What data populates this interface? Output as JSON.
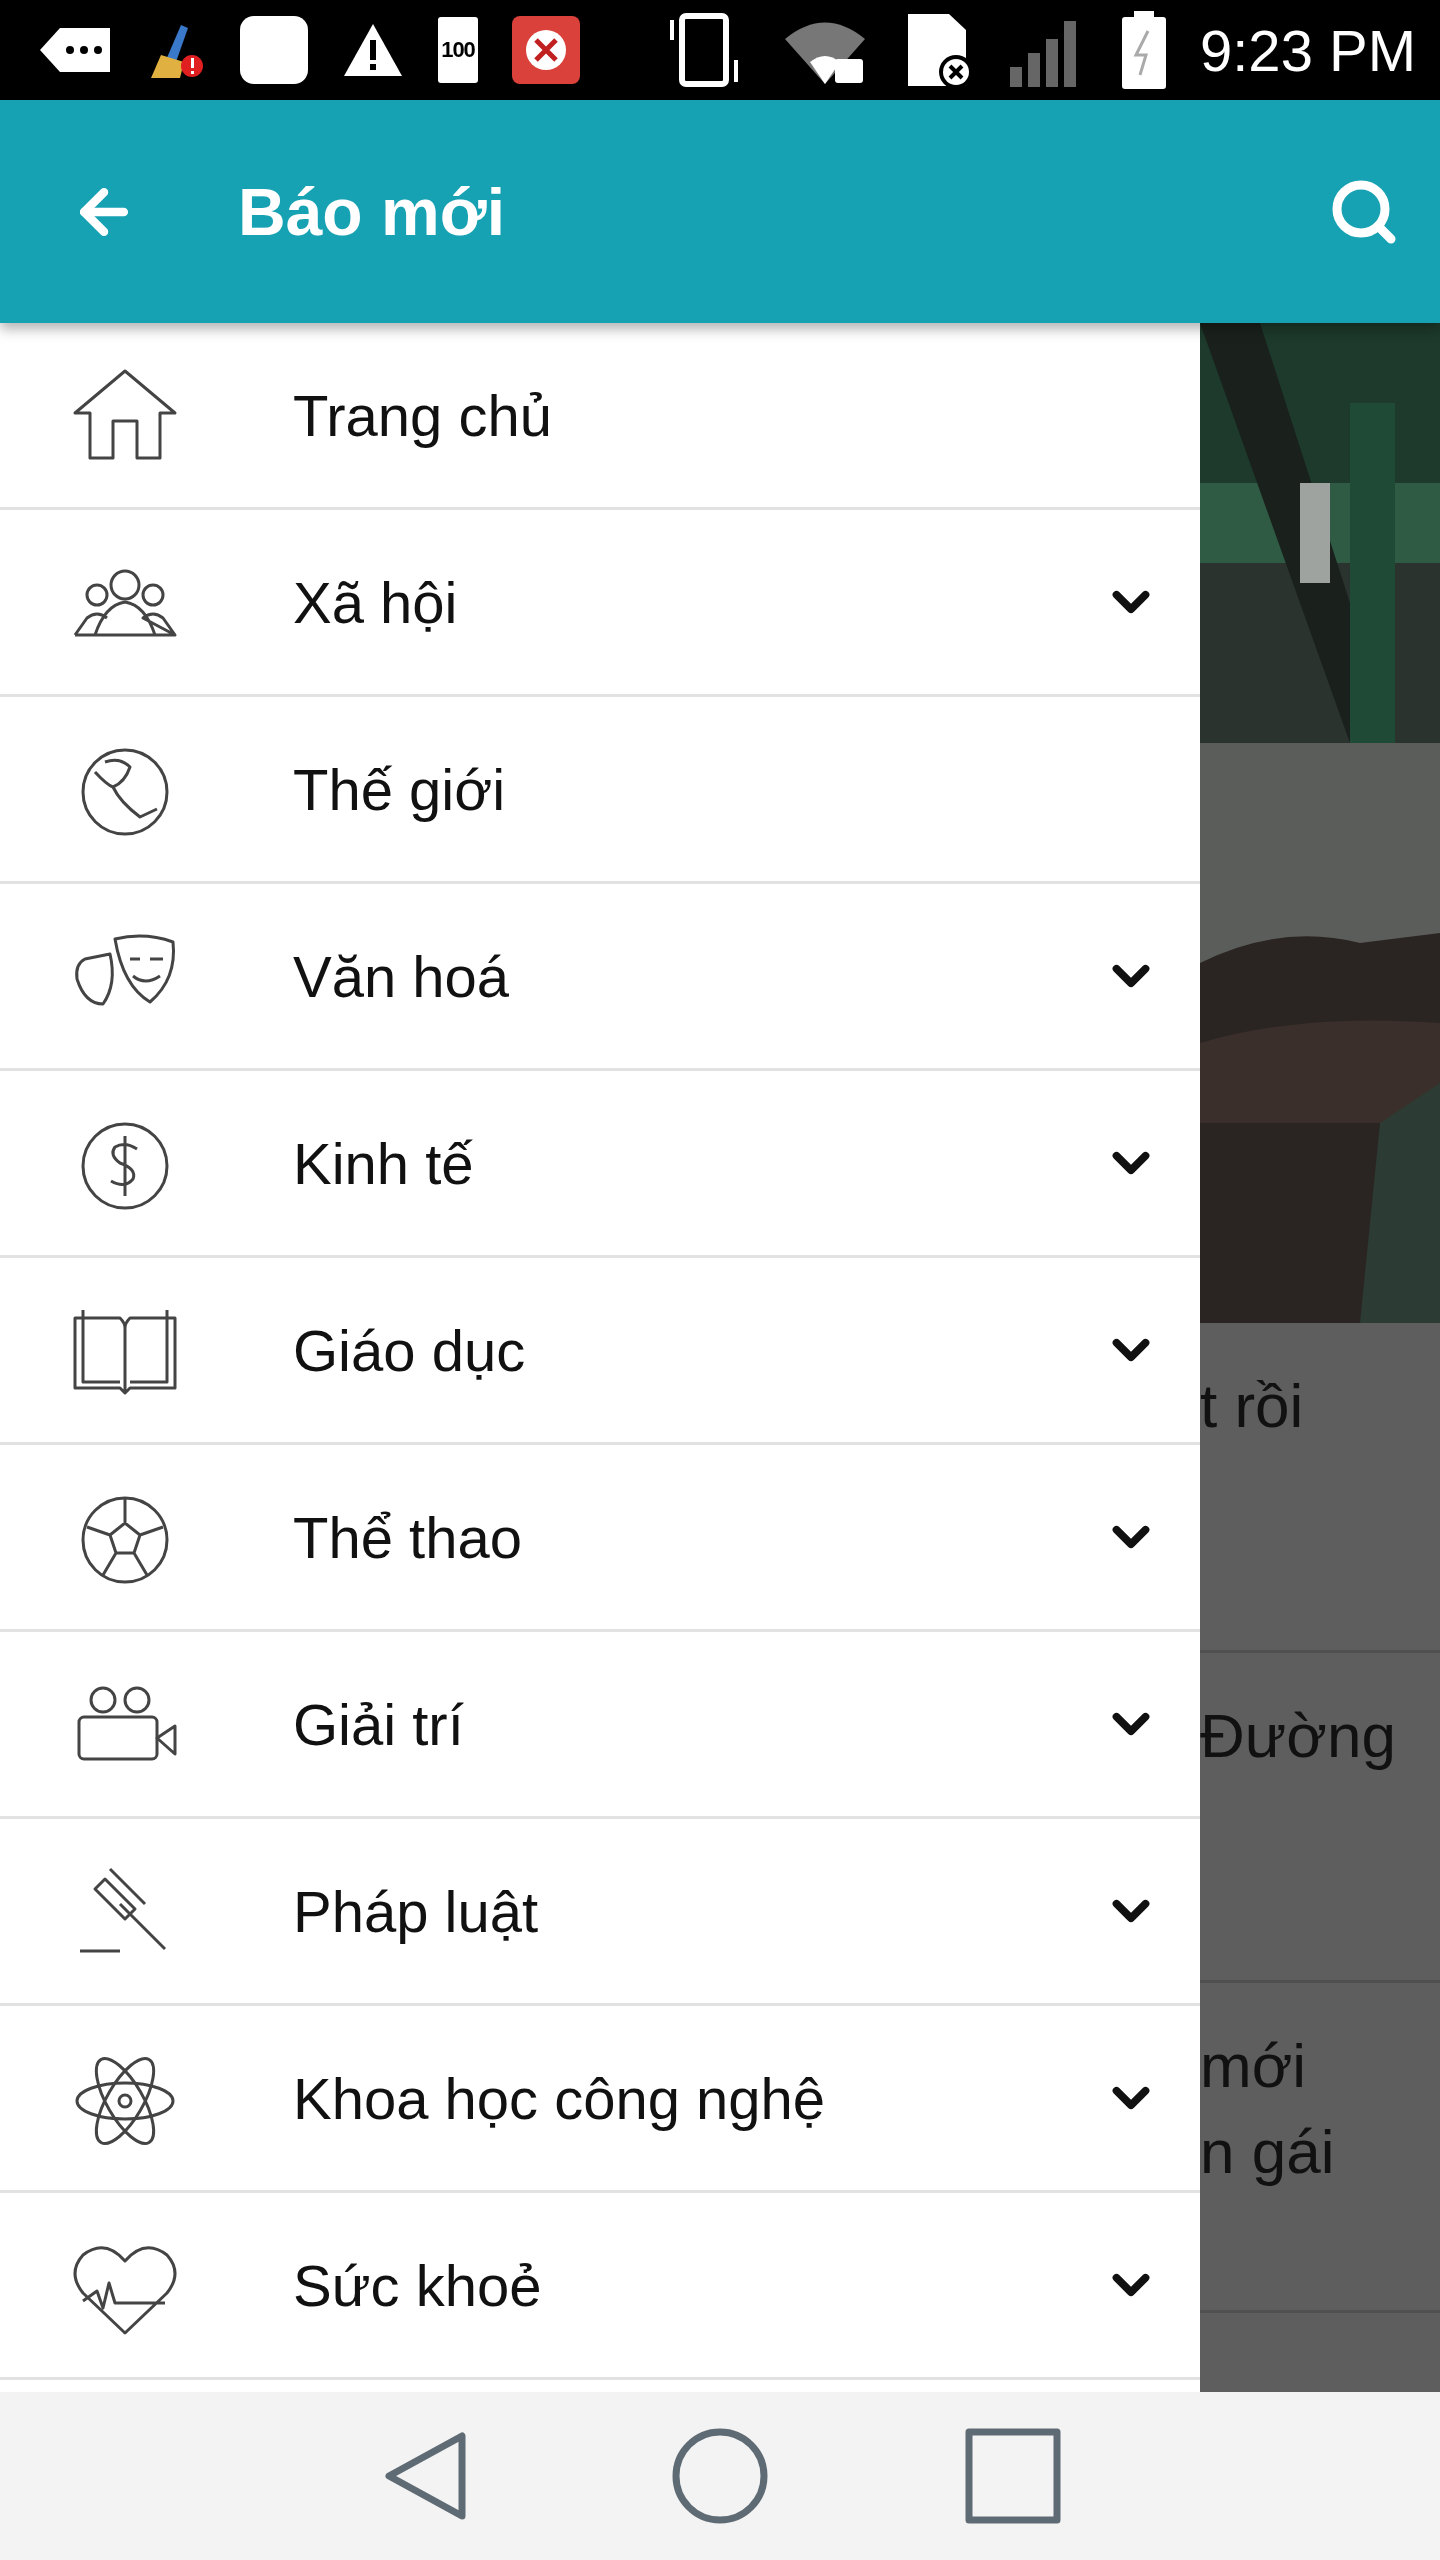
{
  "status_bar": {
    "battery_badge": "100",
    "time": "9:23 PM"
  },
  "app_bar": {
    "title": "Báo mới"
  },
  "drawer": {
    "items": [
      {
        "label": "Trang chủ",
        "kind": "plain"
      },
      {
        "label": "Xã hội",
        "kind": "expandable"
      },
      {
        "label": "Thế giới",
        "kind": "plain"
      },
      {
        "label": "Văn hoá",
        "kind": "expandable"
      },
      {
        "label": "Kinh tế",
        "kind": "expandable"
      },
      {
        "label": "Giáo dục",
        "kind": "expandable"
      },
      {
        "label": "Thể thao",
        "kind": "expandable"
      },
      {
        "label": "Giải trí",
        "kind": "expandable"
      },
      {
        "label": "Pháp luật",
        "kind": "expandable"
      },
      {
        "label": "Khoa học công nghệ",
        "kind": "expandable"
      },
      {
        "label": "Sức khoẻ",
        "kind": "expandable"
      }
    ]
  },
  "background": {
    "articles": [
      {
        "lines": [
          "t rồi"
        ]
      },
      {
        "lines": [
          "Đường"
        ]
      },
      {
        "lines": [
          "mới",
          "n gái"
        ]
      }
    ]
  }
}
